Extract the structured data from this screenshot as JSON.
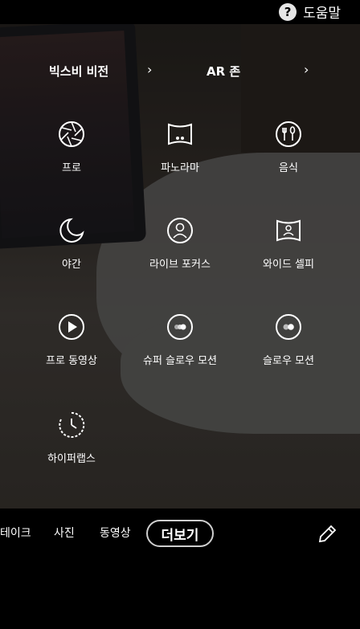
{
  "header": {
    "help_label": "도움말"
  },
  "mode_links": [
    {
      "label": "빅스비 비전"
    },
    {
      "label": "AR 존"
    }
  ],
  "modes": [
    {
      "label": "프로",
      "icon": "aperture-icon"
    },
    {
      "label": "파노라마",
      "icon": "panorama-icon"
    },
    {
      "label": "음식",
      "icon": "food-icon"
    },
    {
      "label": "야간",
      "icon": "moon-icon"
    },
    {
      "label": "라이브 포커스",
      "icon": "live-focus-icon"
    },
    {
      "label": "와이드 셀피",
      "icon": "wide-selfie-icon"
    },
    {
      "label": "프로 동영상",
      "icon": "play-icon"
    },
    {
      "label": "슈퍼 슬로우 모션",
      "icon": "super-slow-motion-icon"
    },
    {
      "label": "슬로우 모션",
      "icon": "slow-motion-icon"
    },
    {
      "label": "하이퍼랩스",
      "icon": "hyperlapse-icon"
    }
  ],
  "bottom_tabs": {
    "take": "테이크",
    "photo": "사진",
    "video": "동영상",
    "more": "더보기"
  }
}
